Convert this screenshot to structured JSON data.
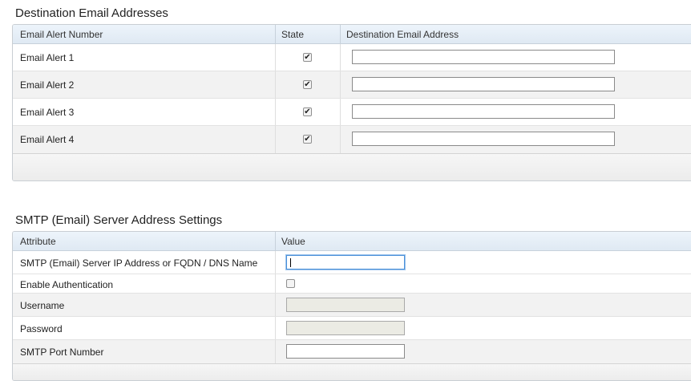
{
  "email_section": {
    "title": "Destination Email Addresses",
    "columns": [
      "Email Alert Number",
      "State",
      "Destination Email Address"
    ],
    "rows": [
      {
        "label": "Email Alert 1",
        "state_checked": true,
        "email": ""
      },
      {
        "label": "Email Alert 2",
        "state_checked": true,
        "email": ""
      },
      {
        "label": "Email Alert 3",
        "state_checked": true,
        "email": ""
      },
      {
        "label": "Email Alert 4",
        "state_checked": true,
        "email": ""
      }
    ]
  },
  "smtp_section": {
    "title": "SMTP (Email) Server Address Settings",
    "columns": [
      "Attribute",
      "Value"
    ],
    "rows": [
      {
        "label": "SMTP (Email) Server IP Address or FQDN / DNS Name",
        "type": "text",
        "value": "",
        "focused": true
      },
      {
        "label": "Enable Authentication",
        "type": "checkbox",
        "checked": false
      },
      {
        "label": "Username",
        "type": "text",
        "value": "",
        "disabled": true
      },
      {
        "label": "Password",
        "type": "text",
        "value": "",
        "disabled": true
      },
      {
        "label": "SMTP Port Number",
        "type": "text",
        "value": ""
      }
    ]
  },
  "icons": {
    "checkmark": "✔"
  },
  "colors": {
    "header_gradient_top": "#edf4fb",
    "header_gradient_bottom": "#dfe9f3",
    "alt_row": "#f2f2f2",
    "focus_border": "#4a90d9"
  }
}
